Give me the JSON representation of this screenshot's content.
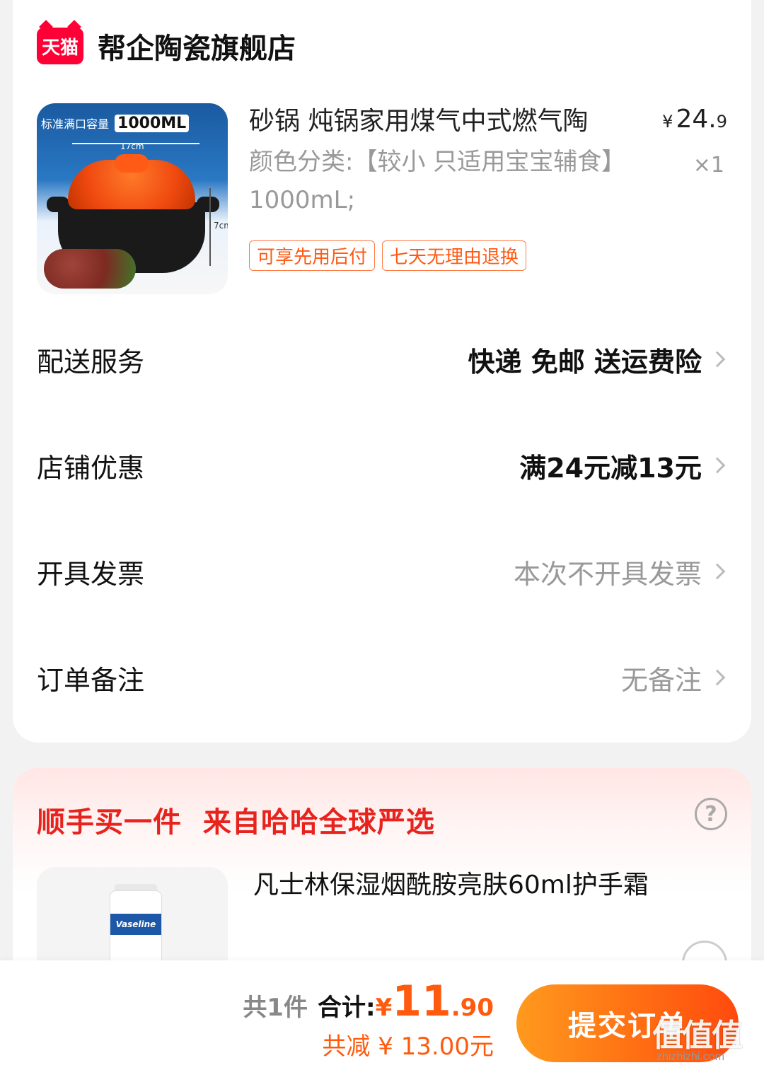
{
  "store": {
    "badge": "天猫",
    "name": "帮企陶瓷旗舰店"
  },
  "product": {
    "image_caption": "标准满口容量",
    "image_capacity": "1000ML",
    "image_dim_width": "17cm",
    "image_dim_height": "7cm",
    "title": "砂锅 炖锅家用煤气中式燃气陶",
    "price_symbol": "¥",
    "price_int": "24.",
    "price_dec": "9",
    "spec": "颜色分类:【较小 只适用宝宝辅食】1000mL;",
    "quantity": "×1",
    "tags": [
      "可享先用后付",
      "七天无理由退换"
    ]
  },
  "rows": {
    "delivery": {
      "label": "配送服务",
      "value": "快递 免邮 送运费险"
    },
    "discount": {
      "label": "店铺优惠",
      "value": "满24元减13元"
    },
    "invoice": {
      "label": "开具发票",
      "value": "本次不开具发票"
    },
    "note": {
      "label": "订单备注",
      "value": "无备注"
    }
  },
  "addon": {
    "title": "顺手买一件  来自哈哈全球严选",
    "help_icon": "question-circle-icon",
    "product_name": "凡士林保湿烟酰胺亮肤60ml护手霜",
    "image_brand": "Vaseline"
  },
  "bottom": {
    "count_text": "共1件",
    "total_label": "合计:",
    "total_yen": "¥",
    "total_int": "11",
    "total_dec": ".90",
    "saved_text": "共减 ¥ 13.00元",
    "submit_label": "提交订单"
  },
  "watermark": {
    "logo": "值值值",
    "url": "zhizhizhi.com"
  },
  "colors": {
    "accent": "#ff5a0d",
    "tmall_red": "#ff0036",
    "addon_title": "#e8231d",
    "muted": "#999999"
  }
}
